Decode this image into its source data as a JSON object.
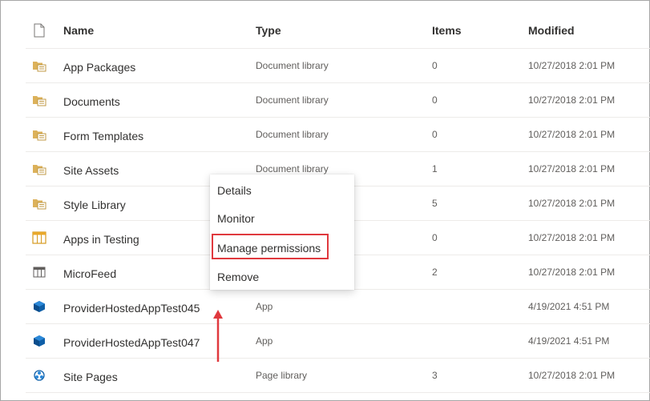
{
  "header": {
    "name": "Name",
    "type": "Type",
    "items": "Items",
    "modified": "Modified",
    "icon": "file-icon"
  },
  "rows": [
    {
      "name": "App Packages",
      "type": "Document library",
      "items": "0",
      "modified": "10/27/2018 2:01 PM",
      "icon": "document-library-icon"
    },
    {
      "name": "Documents",
      "type": "Document library",
      "items": "0",
      "modified": "10/27/2018 2:01 PM",
      "icon": "document-library-icon"
    },
    {
      "name": "Form Templates",
      "type": "Document library",
      "items": "0",
      "modified": "10/27/2018 2:01 PM",
      "icon": "document-library-icon"
    },
    {
      "name": "Site Assets",
      "type": "Document library",
      "items": "1",
      "modified": "10/27/2018 2:01 PM",
      "icon": "document-library-icon"
    },
    {
      "name": "Style Library",
      "type": "",
      "items": "5",
      "modified": "10/27/2018 2:01 PM",
      "icon": "document-library-icon"
    },
    {
      "name": "Apps in Testing",
      "type": "",
      "items": "0",
      "modified": "10/27/2018 2:01 PM",
      "icon": "list-icon"
    },
    {
      "name": "MicroFeed",
      "type": "",
      "items": "2",
      "modified": "10/27/2018 2:01 PM",
      "icon": "table-icon"
    },
    {
      "name": "ProviderHostedAppTest045",
      "type": "App",
      "items": "",
      "modified": "4/19/2021 4:51 PM",
      "icon": "app-icon"
    },
    {
      "name": "ProviderHostedAppTest047",
      "type": "App",
      "items": "",
      "modified": "4/19/2021 4:51 PM",
      "icon": "app-icon"
    },
    {
      "name": "Site Pages",
      "type": "Page library",
      "items": "3",
      "modified": "10/27/2018 2:01 PM",
      "icon": "page-library-icon"
    }
  ],
  "menu": {
    "items": [
      "Details",
      "Monitor",
      "Manage permissions",
      "Remove"
    ],
    "highlighted": "Manage permissions"
  },
  "colors": {
    "highlight": "#e0393e",
    "folder": "#dcb15a",
    "app": "#0f5fa8"
  }
}
